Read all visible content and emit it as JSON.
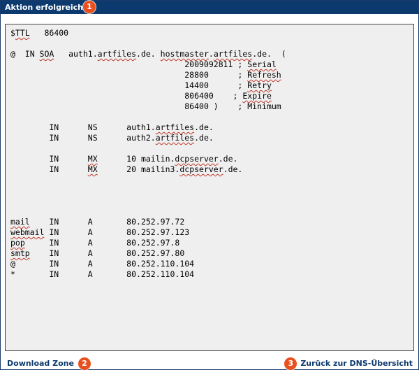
{
  "title_bar": {
    "title": "Aktion erfolgreich!",
    "badge": "1"
  },
  "zone_file": {
    "lines": [
      "$TTL   86400",
      "",
      "@  IN SOA   auth1.artfiles.de. hostmaster.artfiles.de.  (",
      "                                    2009092811 ; Serial",
      "                                    28800      ; Refresh",
      "                                    14400      ; Retry",
      "                                    806400    ; Expire",
      "                                    86400 )    ; Minimum",
      "",
      "        IN      NS      auth1.artfiles.de.",
      "        IN      NS      auth2.artfiles.de.",
      "",
      "        IN      MX      10 mailin.dcpserver.de.",
      "        IN      MX      20 mailin3.dcpserver.de.",
      "",
      "",
      "",
      "",
      "mail    IN      A       80.252.97.72",
      "webmail IN      A       80.252.97.123",
      "pop     IN      A       80.252.97.8",
      "smtp    IN      A       80.252.97.80",
      "@       IN      A       80.252.110.104",
      "*       IN      A       80.252.110.104"
    ],
    "spellcheck_marked_words": [
      "TTL",
      "SOA",
      "artfiles",
      "hostmaster",
      "Serial",
      "Refresh",
      "Retry",
      "Expire",
      "MX",
      "dcpserver",
      "mail",
      "webmail",
      "pop",
      "smtp"
    ]
  },
  "footer": {
    "download_label": "Download Zone",
    "download_badge": "2",
    "back_label": "Zurück zur DNS-Übersicht",
    "back_badge": "3"
  },
  "colors": {
    "title_bar_bg": "#0d3a6e",
    "badge_bg": "#e8501f",
    "link_text": "#0d3a6e",
    "zone_box_bg": "#efefef"
  }
}
